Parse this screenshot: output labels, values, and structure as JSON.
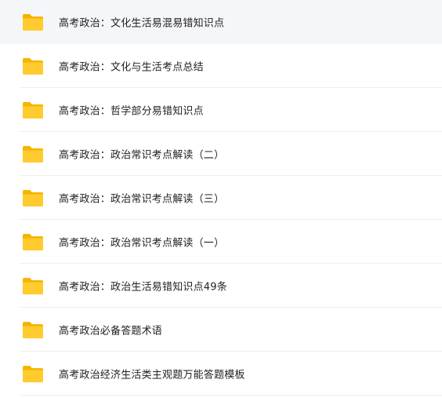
{
  "colors": {
    "folder_back": "#F5B400",
    "folder_front": "#FFCB2E",
    "text": "#1f1f1f",
    "hover_background": "#f5f6fa"
  },
  "files": [
    {
      "name": "高考政治：文化生活易混易错知识点",
      "icon": "folder-icon",
      "hovered": true
    },
    {
      "name": "高考政治：文化与生活考点总结",
      "icon": "folder-icon"
    },
    {
      "name": "高考政治：哲学部分易错知识点",
      "icon": "folder-icon"
    },
    {
      "name": "高考政治：政治常识考点解读（二）",
      "icon": "folder-icon"
    },
    {
      "name": "高考政治：政治常识考点解读（三）",
      "icon": "folder-icon"
    },
    {
      "name": "高考政治：政治常识考点解读（一）",
      "icon": "folder-icon"
    },
    {
      "name": "高考政治：政治生活易错知识点49条",
      "icon": "folder-icon"
    },
    {
      "name": "高考政治必备答题术语",
      "icon": "folder-icon"
    },
    {
      "name": "高考政治经济生活类主观题万能答题模板",
      "icon": "folder-icon"
    }
  ]
}
